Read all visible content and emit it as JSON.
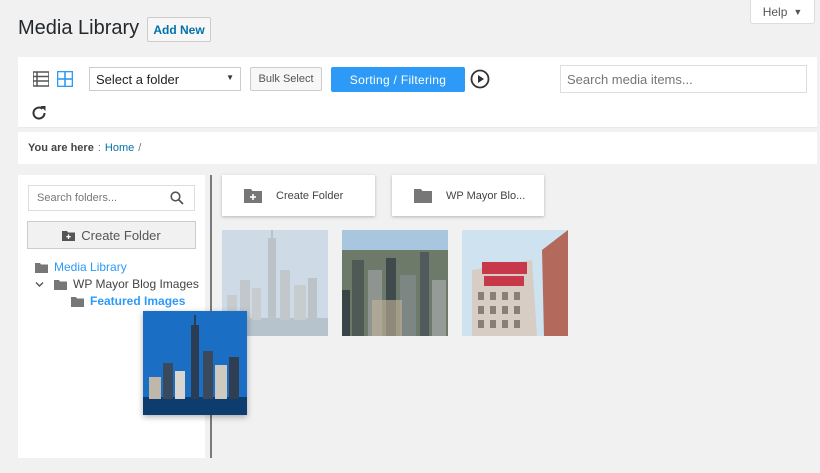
{
  "help": {
    "label": "Help",
    "caret": "▼"
  },
  "header": {
    "title": "Media Library",
    "add_new_label": "Add New"
  },
  "toolbar": {
    "folder_select_value": "Select a folder",
    "folder_select_arrow": "▼",
    "bulk_select_label": "Bulk Select",
    "sort_filter_label": "Sorting / Filtering",
    "search_placeholder": "Search media items..."
  },
  "breadcrumb": {
    "label": "You are here",
    "separator": ":",
    "home": "Home",
    "trail_sep": "/"
  },
  "sidebar": {
    "search_placeholder": "Search folders...",
    "create_folder_label": "Create Folder",
    "tree": [
      {
        "label": "Media Library"
      },
      {
        "label": "WP Mayor Blog Images"
      },
      {
        "label": "Featured Images"
      }
    ]
  },
  "folders": [
    {
      "label": "Create Folder",
      "icon": "folder-plus-icon"
    },
    {
      "label": "WP Mayor Blo...",
      "icon": "folder-icon"
    }
  ],
  "colors": {
    "accent": "#2e9af7",
    "link": "#0073aa",
    "background": "#f1f1f1"
  }
}
